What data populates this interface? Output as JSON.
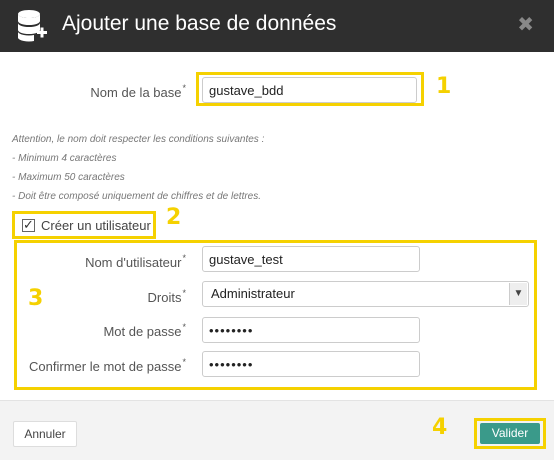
{
  "dialog": {
    "title": "Ajouter une base de données",
    "close_glyph": "✖"
  },
  "form": {
    "db_name": {
      "label": "Nom de la base",
      "required_mark": "*",
      "value": "gustave_bdd"
    },
    "notes": {
      "intro": "Attention, le nom doit respecter les conditions suivantes :",
      "rules": [
        "- Minimum 4 caractères",
        "- Maximum 50 caractères",
        "- Doit être composé uniquement de chiffres et de lettres."
      ]
    },
    "create_user": {
      "label": "Créer un utilisateur",
      "checked": true
    },
    "username": {
      "label": "Nom d'utilisateur",
      "required_mark": "*",
      "value": "gustave_test"
    },
    "rights": {
      "label": "Droits",
      "required_mark": "*",
      "value": "Administrateur"
    },
    "password": {
      "label": "Mot de passe",
      "required_mark": "*",
      "value": "••••••••"
    },
    "confirm_password": {
      "label": "Confirmer le mot de passe",
      "required_mark": "*",
      "value": "••••••••"
    }
  },
  "footer": {
    "cancel_label": "Annuler",
    "validate_label": "Valider"
  },
  "annotations": {
    "n1": "1",
    "n2": "2",
    "n3": "3",
    "n4": "4",
    "color": "#f5d100"
  },
  "icons": {
    "header": "database-add-icon",
    "select_arrow": "chevron-down-icon"
  }
}
